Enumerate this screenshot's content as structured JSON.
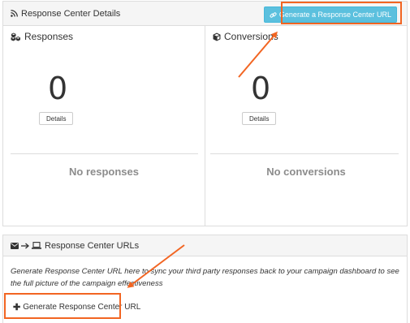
{
  "details_panel": {
    "title": "Response Center Details",
    "generate_button": "Generate a Response Center URL",
    "responses": {
      "title": "Responses",
      "count": "0",
      "details_button": "Details",
      "empty_text": "No responses"
    },
    "conversions": {
      "title": "Conversions",
      "count": "0",
      "details_button": "Details",
      "empty_text": "No conversions"
    }
  },
  "urls_panel": {
    "title": "Response Center URLs",
    "description": "Generate Response Center URL here to sync your third party responses back to your campaign dashboard to see the full picture of the campaign effectiveness",
    "add_button": "Generate Response Center URL"
  },
  "icons": {
    "header": "rss-icon",
    "generate": "link-icon",
    "responses": "cubes-icon",
    "conversions": "cube-icon",
    "urls_header": [
      "envelope-icon",
      "arrow-right-icon",
      "laptop-icon"
    ],
    "add": "plus-icon"
  },
  "colors": {
    "accent_button": "#5bc0de",
    "annotation": "#f26522",
    "panel_header_bg": "#f5f5f5",
    "muted_text": "#8c8c8c"
  }
}
